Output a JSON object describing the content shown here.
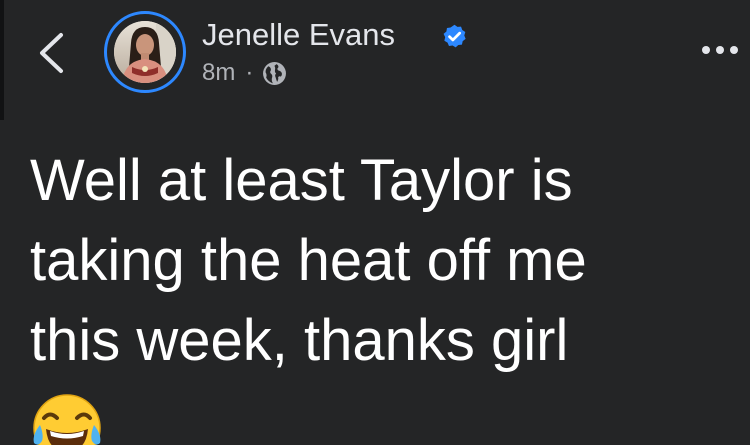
{
  "header": {
    "back_icon": "chevron-left-icon",
    "author_name": "Jenelle Evans",
    "verified_icon": "verified-badge-icon",
    "timestamp": "8m",
    "separator": "·",
    "audience_icon": "globe-icon",
    "more_icon": "more-horizontal-icon"
  },
  "post": {
    "text": "Well at least Taylor is\ntaking the heat off me\nthis week, thanks girl",
    "emoji_icon": "face-with-tears-of-joy-emoji"
  },
  "colors": {
    "background": "#242526",
    "text_primary": "#ffffff",
    "text_secondary": "#b0b3b8",
    "accent": "#2d88ff"
  }
}
